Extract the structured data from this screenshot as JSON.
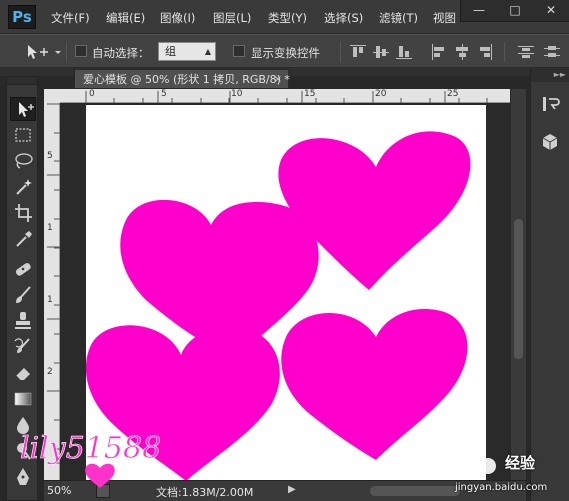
{
  "app": {
    "logo": "Ps",
    "menu": [
      "文件(F)",
      "编辑(E)",
      "图像(I)",
      "图层(L)",
      "类型(Y)",
      "选择(S)",
      "滤镜(T)",
      "视图"
    ],
    "window_controls": [
      "minimize-icon",
      "maximize-icon",
      "close-icon"
    ]
  },
  "options": {
    "auto_select_label": "自动选择：",
    "auto_select_value": "组",
    "show_transform_label": "显示变换控件"
  },
  "document": {
    "tab_title": "爱心模板 @ 50% (形状 1 拷贝, RGB/8) *",
    "tab_close": "×",
    "ruler_h_labels": [
      "0",
      "5",
      "10",
      "15",
      "20",
      "25"
    ],
    "ruler_v_labels": [
      "5",
      "1",
      "1",
      "2"
    ],
    "canvas_color": "#ffffff",
    "heart_color": "#ff00cc"
  },
  "status": {
    "zoom": "50%",
    "doc_info": "文档:1.83M/2.00M"
  },
  "watermark": {
    "signature": "lily51588",
    "brand": "经验",
    "url": "jingyan.baidu.com"
  }
}
